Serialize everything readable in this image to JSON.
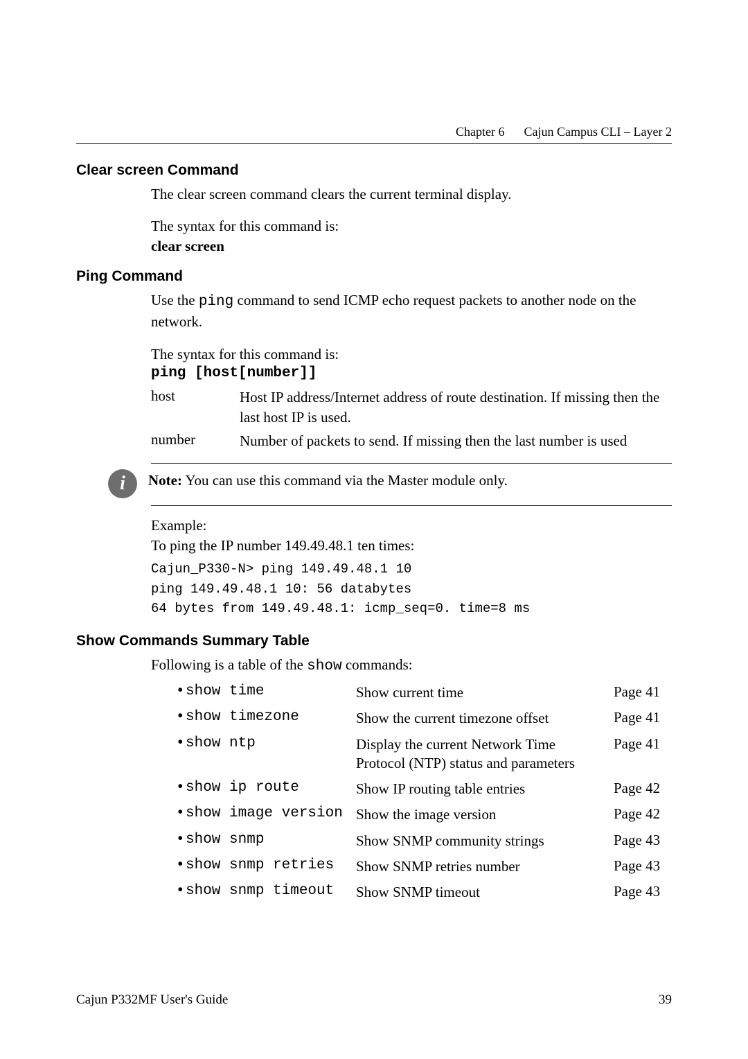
{
  "header": {
    "chapter": "Chapter 6",
    "title": "Cajun Campus CLI – Layer 2"
  },
  "sec1": {
    "title": "Clear screen Command",
    "body": "The clear screen command clears the current terminal display.",
    "syn_label": "The syntax for this command is:",
    "syn_cmd": "clear screen"
  },
  "sec2": {
    "title": "Ping Command",
    "body_pre": "Use the ",
    "body_mono": "ping",
    "body_post": " command to send ICMP echo request packets to another node on the network.",
    "syn_label": "The syntax for this command is:",
    "syn_cmd": "ping [host[number]]",
    "params": [
      {
        "name": "host",
        "desc": "Host IP address/Internet address of route destination. If missing then the last host IP is used."
      },
      {
        "name": "number",
        "desc": "Number of packets to send. If missing then the last number is used"
      }
    ],
    "note_label": "Note:",
    "note_body": " You can use this command via the Master module only.",
    "ex_label": "Example:",
    "ex_body": "To ping the IP number 149.49.48.1 ten times:",
    "code": "Cajun_P330-N> ping 149.49.48.1 10\nping 149.49.48.1 10: 56 databytes\n64 bytes from 149.49.48.1: icmp_seq=0. time=8 ms"
  },
  "sec3": {
    "title": "Show Commands Summary Table",
    "intro_pre": "Following is a table of the ",
    "intro_mono": "show",
    "intro_post": " commands:",
    "rows": [
      {
        "cmd": "show time",
        "desc": "Show current time",
        "page": "Page 41"
      },
      {
        "cmd": "show timezone",
        "desc": "Show the current timezone offset",
        "page": "Page 41"
      },
      {
        "cmd": "show ntp",
        "desc": "Display the current Network Time Protocol (NTP) status and parameters",
        "page": "Page 41"
      },
      {
        "cmd": "show ip route",
        "desc": "Show IP routing table entries",
        "page": "Page 42"
      },
      {
        "cmd": "show image version",
        "desc": "Show the image version",
        "page": "Page 42"
      },
      {
        "cmd": "show snmp",
        "desc": "Show SNMP community strings",
        "page": "Page 43"
      },
      {
        "cmd": "show snmp retries",
        "desc": "Show SNMP retries number",
        "page": "Page 43"
      },
      {
        "cmd": "show snmp timeout",
        "desc": "Show SNMP timeout",
        "page": "Page 43"
      }
    ]
  },
  "footer": {
    "left": "Cajun P332MF User's Guide",
    "right": "39"
  }
}
